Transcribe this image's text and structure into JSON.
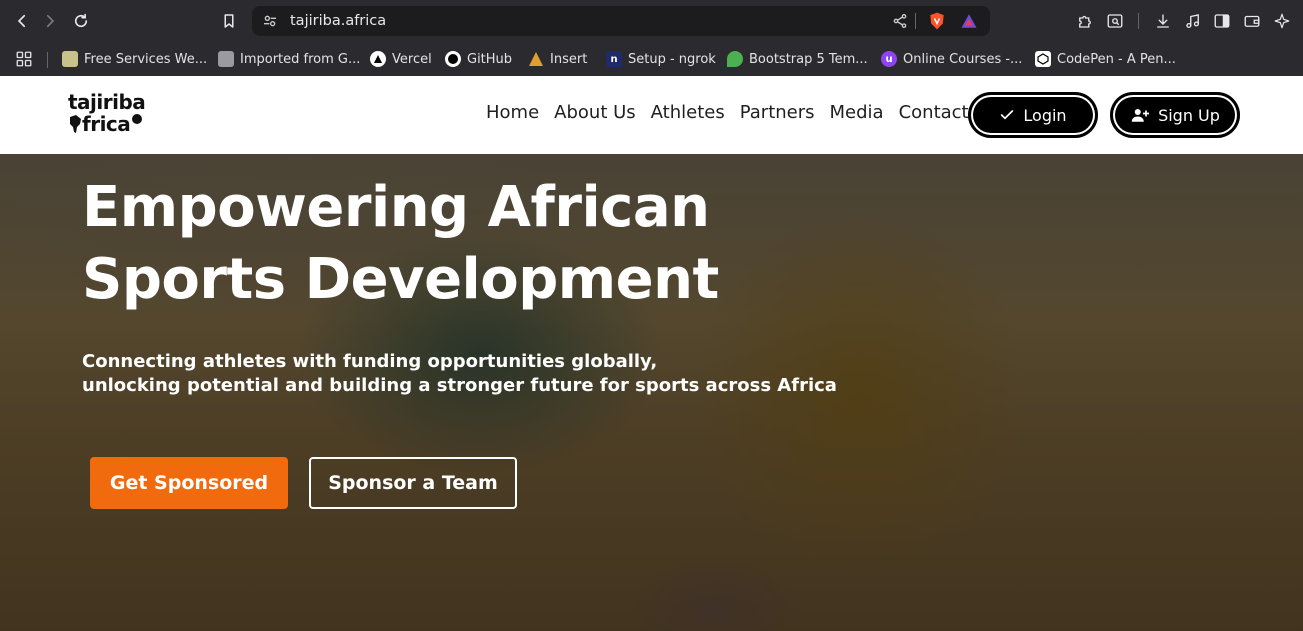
{
  "browser": {
    "url": "tajiriba.africa",
    "bookmarks": [
      {
        "label": "Free Services We...",
        "icon": "free-services-icon"
      },
      {
        "label": "Imported from G...",
        "icon": "folder-icon"
      },
      {
        "label": "Vercel",
        "icon": "vercel-icon"
      },
      {
        "label": "GitHub",
        "icon": "github-icon"
      },
      {
        "label": "Insert",
        "icon": "insert-icon"
      },
      {
        "label": "Setup - ngrok",
        "icon": "ngrok-icon"
      },
      {
        "label": "Bootstrap 5 Tem...",
        "icon": "bootstrap-icon"
      },
      {
        "label": "Online Courses -...",
        "icon": "courses-icon"
      },
      {
        "label": "CodePen - A Pen...",
        "icon": "codepen-icon"
      }
    ]
  },
  "site": {
    "logo": {
      "line1": "tajiriba",
      "line2": "frica"
    },
    "nav": [
      "Home",
      "About Us",
      "Athletes",
      "Partners",
      "Media",
      "Contact"
    ],
    "login_label": "Login",
    "signup_label": "Sign Up"
  },
  "hero": {
    "title_line1": "Empowering African",
    "title_line2": "Sports Development",
    "subtitle_line1": "Connecting athletes with funding opportunities globally,",
    "subtitle_line2": "unlocking potential and building a stronger future for sports across Africa",
    "cta_primary": "Get Sponsored",
    "cta_secondary": "Sponsor a Team"
  },
  "colors": {
    "accent": "#f26a0e",
    "chrome": "#2b2b2f",
    "nav_bg": "#ffffff"
  }
}
